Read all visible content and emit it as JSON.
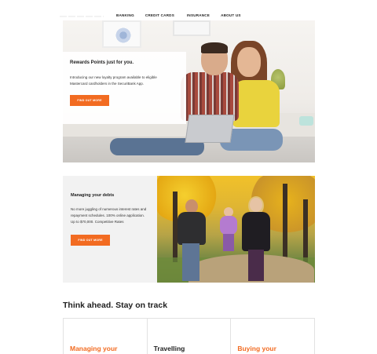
{
  "nav": {
    "items": [
      "BANKING",
      "CREDIT CARDS",
      "INSURANCE",
      "ABOUT US"
    ]
  },
  "hero": {
    "title": "Rewards Points just for you.",
    "body": "Introducing our new loyalty program available to eligible Mastercard cardholders in the SecuriBank App.",
    "button": "FIND OUT MORE"
  },
  "debts": {
    "title": "Managing your debts",
    "body": "No more juggling of numerous interest rates and repayment schedules. 100% online application. Up to $70,000. Competitive Rates",
    "button": "FIND OUT MORE"
  },
  "think_ahead": {
    "heading": "Think ahead. Stay on track",
    "tiles": [
      {
        "title": "Managing your",
        "color": "#f26b21"
      },
      {
        "title": "Travelling",
        "color": "#1f1f1f"
      },
      {
        "title": "Buying your",
        "color": "#f26b21"
      }
    ]
  },
  "colors": {
    "accent": "#f26b21",
    "panel_bg": "#f2f2f2"
  },
  "images": {
    "hero_photo": "couple-with-laptop-photo",
    "park_photo": "family-in-park-photo"
  }
}
